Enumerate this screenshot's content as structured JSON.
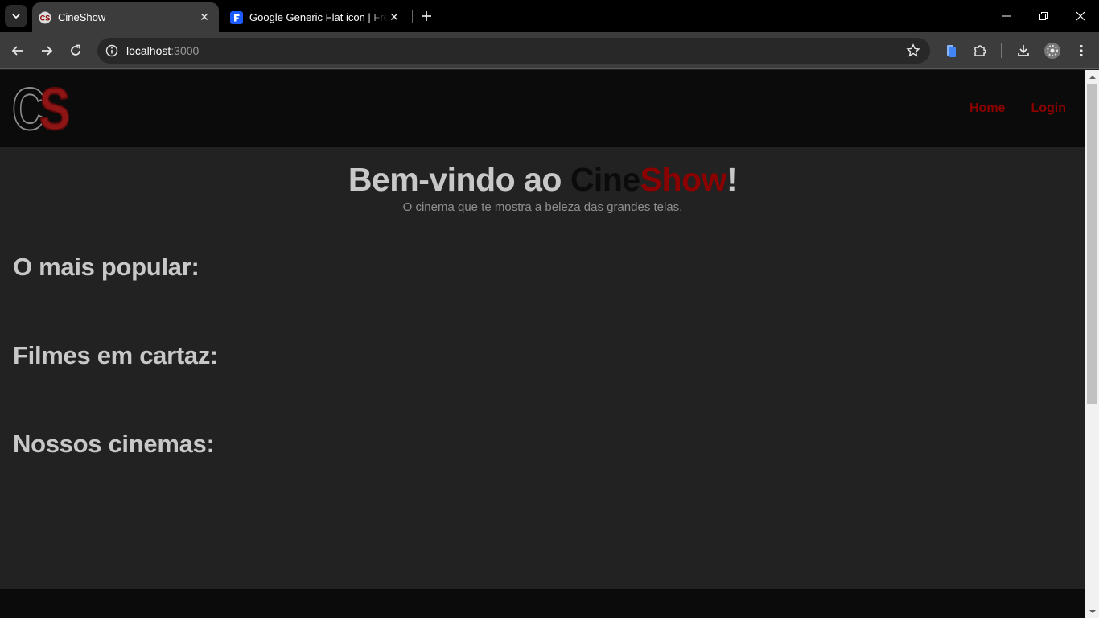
{
  "browser": {
    "tabs": [
      {
        "title": "CineShow",
        "active": true,
        "favicon": "cineshow-favicon"
      },
      {
        "title": "Google Generic Flat icon | Freepik",
        "active": false,
        "favicon": "freepik-favicon"
      }
    ],
    "address": {
      "host": "localhost",
      "port": ":3000"
    },
    "colors": {
      "tabbar": "#000000",
      "toolbar": "#3c3c3c",
      "omnibox": "#282828"
    }
  },
  "site": {
    "logo": {
      "c": "C",
      "s": "S"
    },
    "nav": [
      {
        "label": "Home"
      },
      {
        "label": "Login"
      }
    ],
    "hero": {
      "title_prefix": "Bem-vindo ao ",
      "title_cine": "Cine",
      "title_show": "Show",
      "title_suffix": "!",
      "subtitle": "O cinema que te mostra a beleza das grandes telas."
    },
    "sections": [
      {
        "title": "O mais popular:"
      },
      {
        "title": "Filmes em cartaz:"
      },
      {
        "title": "Nossos cinemas:"
      }
    ],
    "colors": {
      "accent": "#8b0000",
      "background": "#222222",
      "header": "#0b0b0b",
      "text": "#c8c8c8"
    }
  }
}
